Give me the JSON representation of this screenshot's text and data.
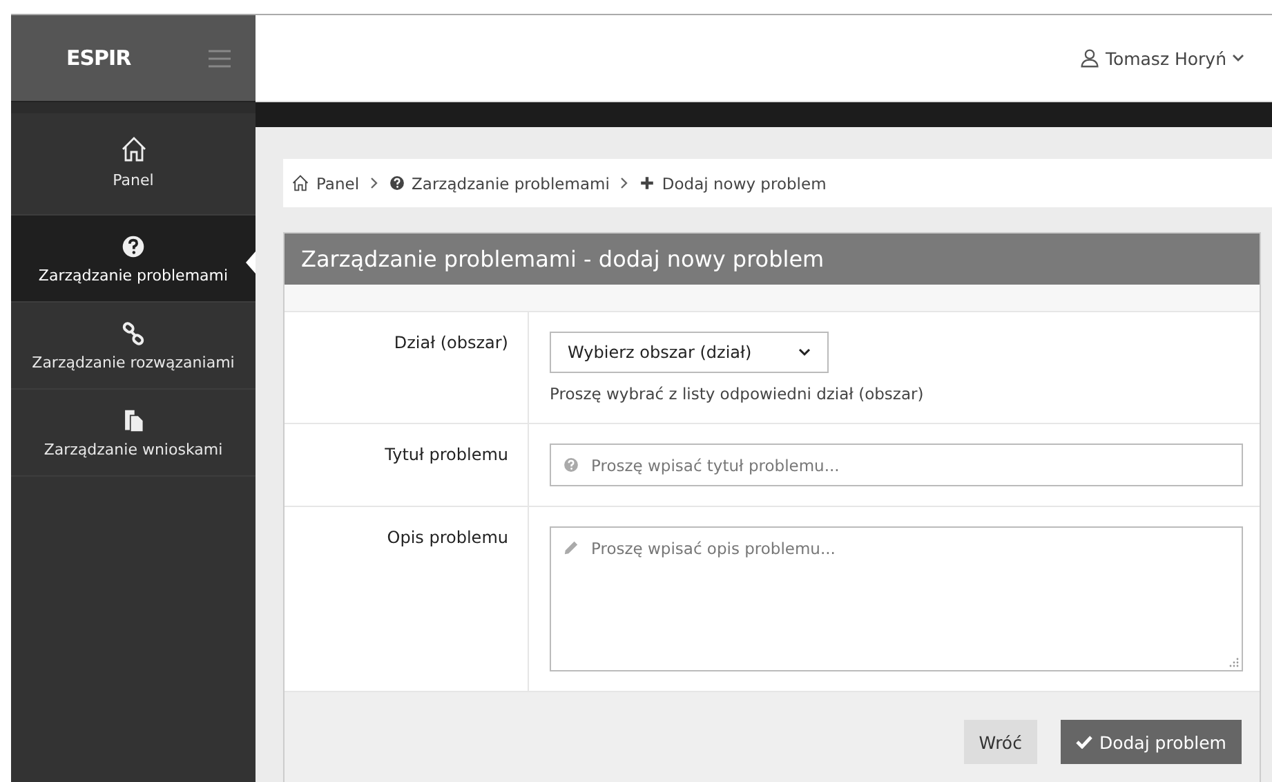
{
  "app": {
    "title": "ESPIR"
  },
  "user": {
    "name": "Tomasz Horyń"
  },
  "sidebar": {
    "items": [
      {
        "label": "Panel",
        "kind": "home",
        "selected": false
      },
      {
        "label": "Zarządzanie problemami",
        "kind": "question",
        "selected": true
      },
      {
        "label": "Zarządzanie rozwązaniami",
        "kind": "link",
        "selected": false
      },
      {
        "label": "Zarządzanie wnioskami",
        "kind": "documents",
        "selected": false
      }
    ]
  },
  "breadcrumb": [
    {
      "label": "Panel",
      "kind": "home"
    },
    {
      "label": "Zarządzanie problemami",
      "kind": "question"
    },
    {
      "label": "Dodaj nowy problem",
      "kind": "plus"
    }
  ],
  "form": {
    "title": "Zarządzanie problemami - dodaj nowy problem",
    "fields": [
      {
        "label": "Dział (obszar)",
        "kind": "select",
        "value": "Wybierz obszar (dział)",
        "help": "Proszę wybrać z listy odpowiedni dział (obszar)"
      },
      {
        "label": "Tytuł problemu",
        "kind": "text",
        "placeholder": "Proszę wpisać tytuł problemu..."
      },
      {
        "label": "Opis problemu",
        "kind": "textarea",
        "placeholder": "Proszę wpisać opis problemu..."
      }
    ],
    "buttons": [
      {
        "label": "Wróć",
        "kind": "secondary"
      },
      {
        "label": "Dodaj problem",
        "kind": "primary"
      }
    ]
  }
}
